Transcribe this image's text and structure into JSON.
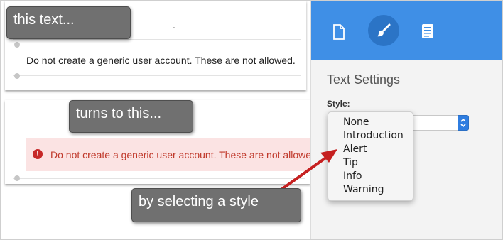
{
  "left": {
    "original_paragraph": "Do not create a generic user account. These are not allowed.",
    "original_cut_text": ".",
    "alert_paragraph": "Do not create a generic user account. These are not allowed."
  },
  "callouts": {
    "first": "this text...",
    "second": "turns to this...",
    "third": "by selecting a style"
  },
  "panel": {
    "tabs": [
      {
        "icon": "document-icon",
        "active": false
      },
      {
        "icon": "brush-icon",
        "active": true
      },
      {
        "icon": "notes-icon",
        "active": false
      }
    ],
    "section_title": "Text Settings",
    "style_label": "Style:",
    "style_options": [
      "None",
      "Introduction",
      "Alert",
      "Tip",
      "Info",
      "Warning"
    ],
    "alert_icon_glyph": "!"
  },
  "colors": {
    "header": "#3f8fe6",
    "active_tab": "#2b74c6",
    "alert_bg": "#fbe3e3",
    "alert_text": "#c0392b",
    "callout_bg": "#707070",
    "arrow": "#c62020"
  }
}
